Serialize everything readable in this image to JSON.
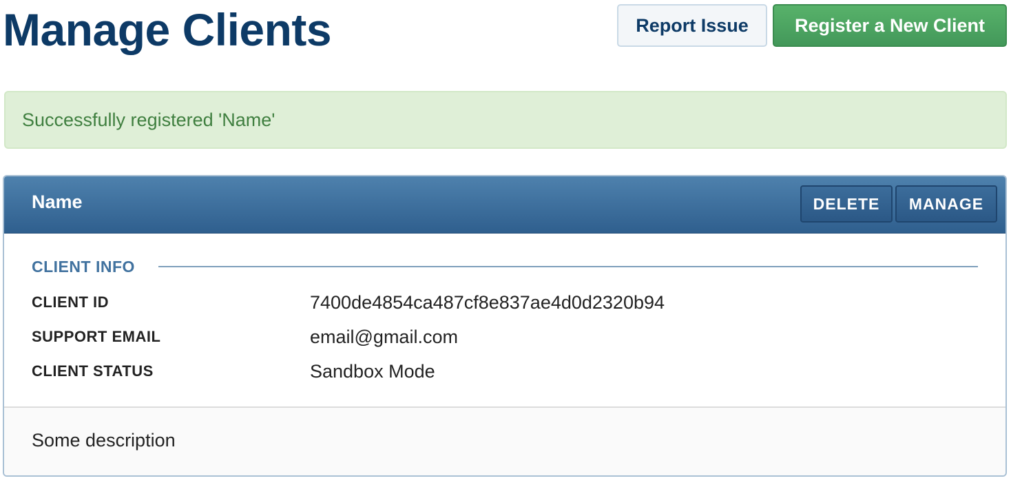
{
  "header": {
    "title": "Manage Clients",
    "report_issue_label": "Report Issue",
    "register_label": "Register a New Client"
  },
  "alert": {
    "message": "Successfully registered 'Name'",
    "type": "success"
  },
  "client": {
    "name": "Name",
    "delete_label": "DELETE",
    "manage_label": "MANAGE",
    "section_heading": "CLIENT INFO",
    "fields": [
      {
        "label": "CLIENT ID",
        "value": "7400de4854ca487cf8e837ae4d0d2320b94"
      },
      {
        "label": "SUPPORT EMAIL",
        "value": "email@gmail.com"
      },
      {
        "label": "CLIENT STATUS",
        "value": "Sandbox Mode"
      }
    ],
    "description": "Some description"
  },
  "colors": {
    "title": "#0d3a66",
    "register_button": "#4aa45e",
    "alert_background": "#dfefd7",
    "alert_text": "#3f7f3f",
    "card_header": "#3b6d9c",
    "section_heading": "#41729f"
  }
}
